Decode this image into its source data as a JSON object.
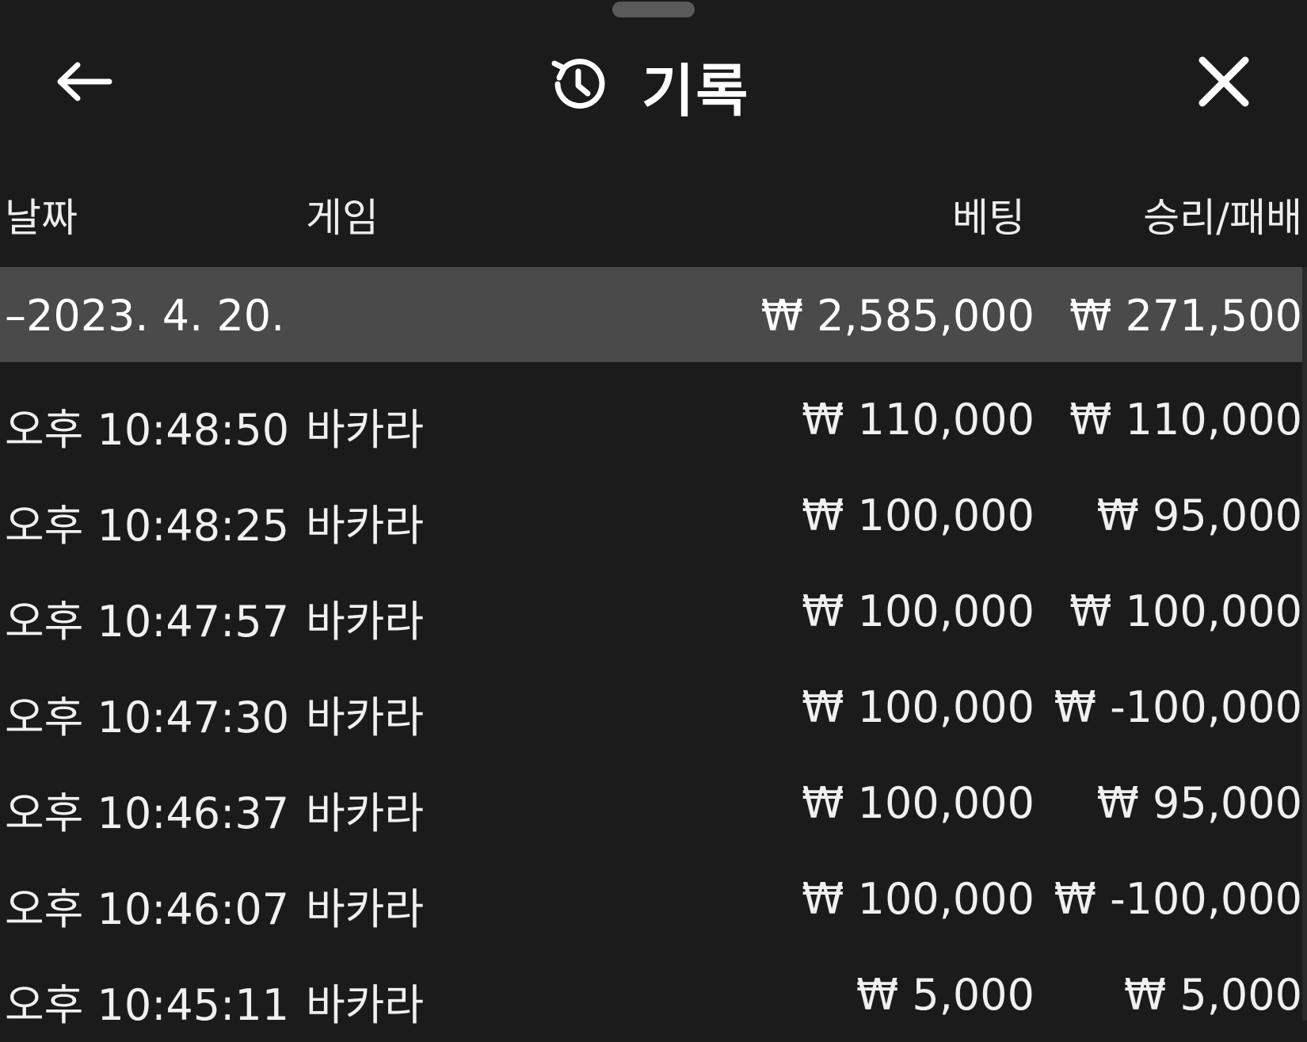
{
  "header": {
    "title": "기록",
    "back_icon": "arrow-left-icon",
    "history_icon": "history-clock-icon",
    "close_icon": "close-icon"
  },
  "columns": {
    "date": "날짜",
    "game": "게임",
    "bet": "베팅",
    "result": "승리/패배"
  },
  "summary": {
    "date": "–2023. 4. 20.",
    "bet": "₩ 2,585,000",
    "result": "₩ 271,500"
  },
  "rows": [
    {
      "time": "오후 10:48:50",
      "game": "바카라",
      "bet": "₩ 110,000",
      "result": "₩ 110,000"
    },
    {
      "time": "오후 10:48:25",
      "game": "바카라",
      "bet": "₩ 100,000",
      "result": "₩ 95,000"
    },
    {
      "time": "오후 10:47:57",
      "game": "바카라",
      "bet": "₩ 100,000",
      "result": "₩ 100,000"
    },
    {
      "time": "오후 10:47:30",
      "game": "바카라",
      "bet": "₩ 100,000",
      "result": "₩ -100,000"
    },
    {
      "time": "오후 10:46:37",
      "game": "바카라",
      "bet": "₩ 100,000",
      "result": "₩ 95,000"
    },
    {
      "time": "오후 10:46:07",
      "game": "바카라",
      "bet": "₩ 100,000",
      "result": "₩ -100,000"
    },
    {
      "time": "오후 10:45:11",
      "game": "바카라",
      "bet": "₩ 5,000",
      "result": "₩ 5,000"
    }
  ],
  "colors": {
    "background": "#1b1b1b",
    "summary_row": "#4a4a4a",
    "text": "#f0f0f0"
  }
}
